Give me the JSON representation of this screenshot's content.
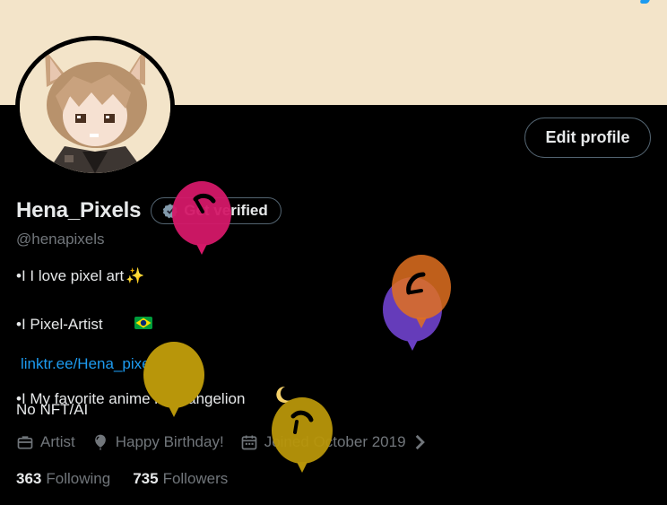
{
  "profile": {
    "display_name": "Hena_Pixels",
    "handle": "@henapixels",
    "edit_profile_label": "Edit profile",
    "get_verified_label": "Get verified",
    "bio_lines": [
      {
        "text": "•I I love pixel art",
        "emoji": "✨"
      },
      {
        "text": "•I Pixel-Artist ",
        "emoji": "🇧🇷"
      },
      {
        "text": "•I My favorite anime is Evangelion",
        "emoji": "🌙"
      }
    ],
    "link": "linktr.ee/Hena_pixel",
    "note": "No NFT/AI",
    "meta": {
      "profession": "Artist",
      "birthday": "Happy Birthday!",
      "joined": "Joined October 2019"
    },
    "following_count": "363",
    "following_label": "Following",
    "followers_count": "735",
    "followers_label": "Followers"
  },
  "colors": {
    "banner": "#f3e4c9",
    "background": "#000000",
    "link": "#1d9bf0",
    "secondary_text": "#71767b",
    "balloon_pink": "#d41868",
    "balloon_orange": "#e07020",
    "balloon_purple": "#6a3fc4",
    "balloon_gold": "#b8960a"
  },
  "icons": [
    "briefcase-icon",
    "balloon-icon",
    "calendar-icon",
    "chevron-right-icon",
    "verified-badge-icon"
  ]
}
